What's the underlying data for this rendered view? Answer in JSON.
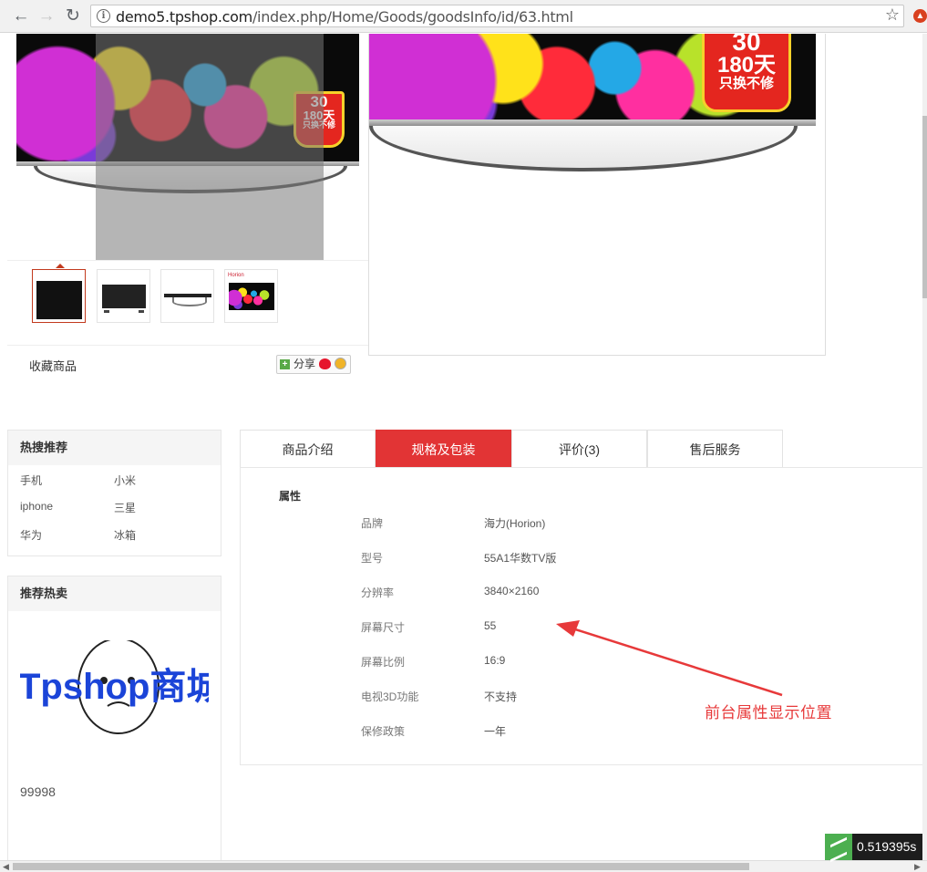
{
  "browser": {
    "url_domain": "demo5.tpshop.com",
    "url_path": "/index.php/Home/Goods/goodsInfo/id/63.html"
  },
  "gallery": {
    "badge_top": "30",
    "badge_days": "180天",
    "badge_sub": "只换不修",
    "thumb_brand": "Horion",
    "favorite_label": "收藏商品",
    "share_label": "分享"
  },
  "hot_search": {
    "title": "热搜推荐",
    "items": [
      "手机",
      "小米",
      "iphone",
      "三星",
      "华为",
      "冰箱"
    ]
  },
  "recommend": {
    "title": "推荐热卖",
    "logo_text": "Tpshop商城",
    "price": "99998"
  },
  "tabs": [
    {
      "label": "商品介绍",
      "active": false
    },
    {
      "label": "规格及包装",
      "active": true
    },
    {
      "label": "评价(3)",
      "active": false
    },
    {
      "label": "售后服务",
      "active": false
    }
  ],
  "specs": {
    "group_title": "属性",
    "rows": [
      {
        "name": "品牌",
        "value": "海力(Horion)"
      },
      {
        "name": "型号",
        "value": "55A1华数TV版"
      },
      {
        "name": "分辨率",
        "value": "3840×2160"
      },
      {
        "name": "屏幕尺寸",
        "value": "55"
      },
      {
        "name": "屏幕比例",
        "value": "16:9"
      },
      {
        "name": "电视3D功能",
        "value": "不支持"
      },
      {
        "name": "保修政策",
        "value": "一年"
      }
    ]
  },
  "annotation": {
    "text": "前台属性显示位置",
    "color": "#e7393a"
  },
  "timer": "0.519395s",
  "colors": {
    "accent": "#e23435",
    "thumb_active_border": "#c23a1e"
  }
}
